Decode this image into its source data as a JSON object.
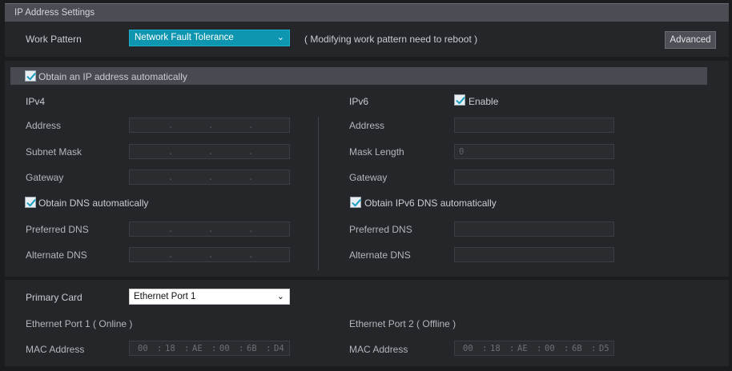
{
  "title": "IP Address Settings",
  "work_pattern": {
    "label": "Work Pattern",
    "value": "Network Fault Tolerance",
    "note": "( Modifying work pattern need to reboot )",
    "advanced_label": "Advanced"
  },
  "obtain_ip": {
    "label": "Obtain an IP address automatically",
    "checked": true
  },
  "ipv4": {
    "heading": "IPv4",
    "address_label": "Address",
    "subnet_label": "Subnet Mask",
    "gateway_label": "Gateway",
    "dns_auto_label": "Obtain DNS automatically",
    "dns_auto_checked": true,
    "preferred_dns_label": "Preferred DNS",
    "alternate_dns_label": "Alternate DNS"
  },
  "ipv6": {
    "heading": "IPv6",
    "enable_label": "Enable",
    "enable_checked": true,
    "address_label": "Address",
    "mask_length_label": "Mask Length",
    "mask_length_value": "0",
    "gateway_label": "Gateway",
    "dns_auto_label": "Obtain IPv6 DNS automatically",
    "dns_auto_checked": true,
    "preferred_dns_label": "Preferred DNS",
    "alternate_dns_label": "Alternate DNS"
  },
  "primary_card": {
    "label": "Primary Card",
    "value": "Ethernet Port 1"
  },
  "port1": {
    "heading": "Ethernet Port 1 ( Online )",
    "mac_label": "MAC Address",
    "mac": [
      "00",
      "18",
      "AE",
      "00",
      "6B",
      "D4"
    ]
  },
  "port2": {
    "heading": "Ethernet Port 2 ( Offline )",
    "mac_label": "MAC Address",
    "mac": [
      "00",
      "18",
      "AE",
      "00",
      "6B",
      "D5"
    ]
  },
  "ip_separator": ".",
  "mac_separator": ":",
  "colors": {
    "accent": "#0e96b0",
    "checkbox_tick": "#1a9fc0",
    "titlebar": "#4a4d53"
  }
}
